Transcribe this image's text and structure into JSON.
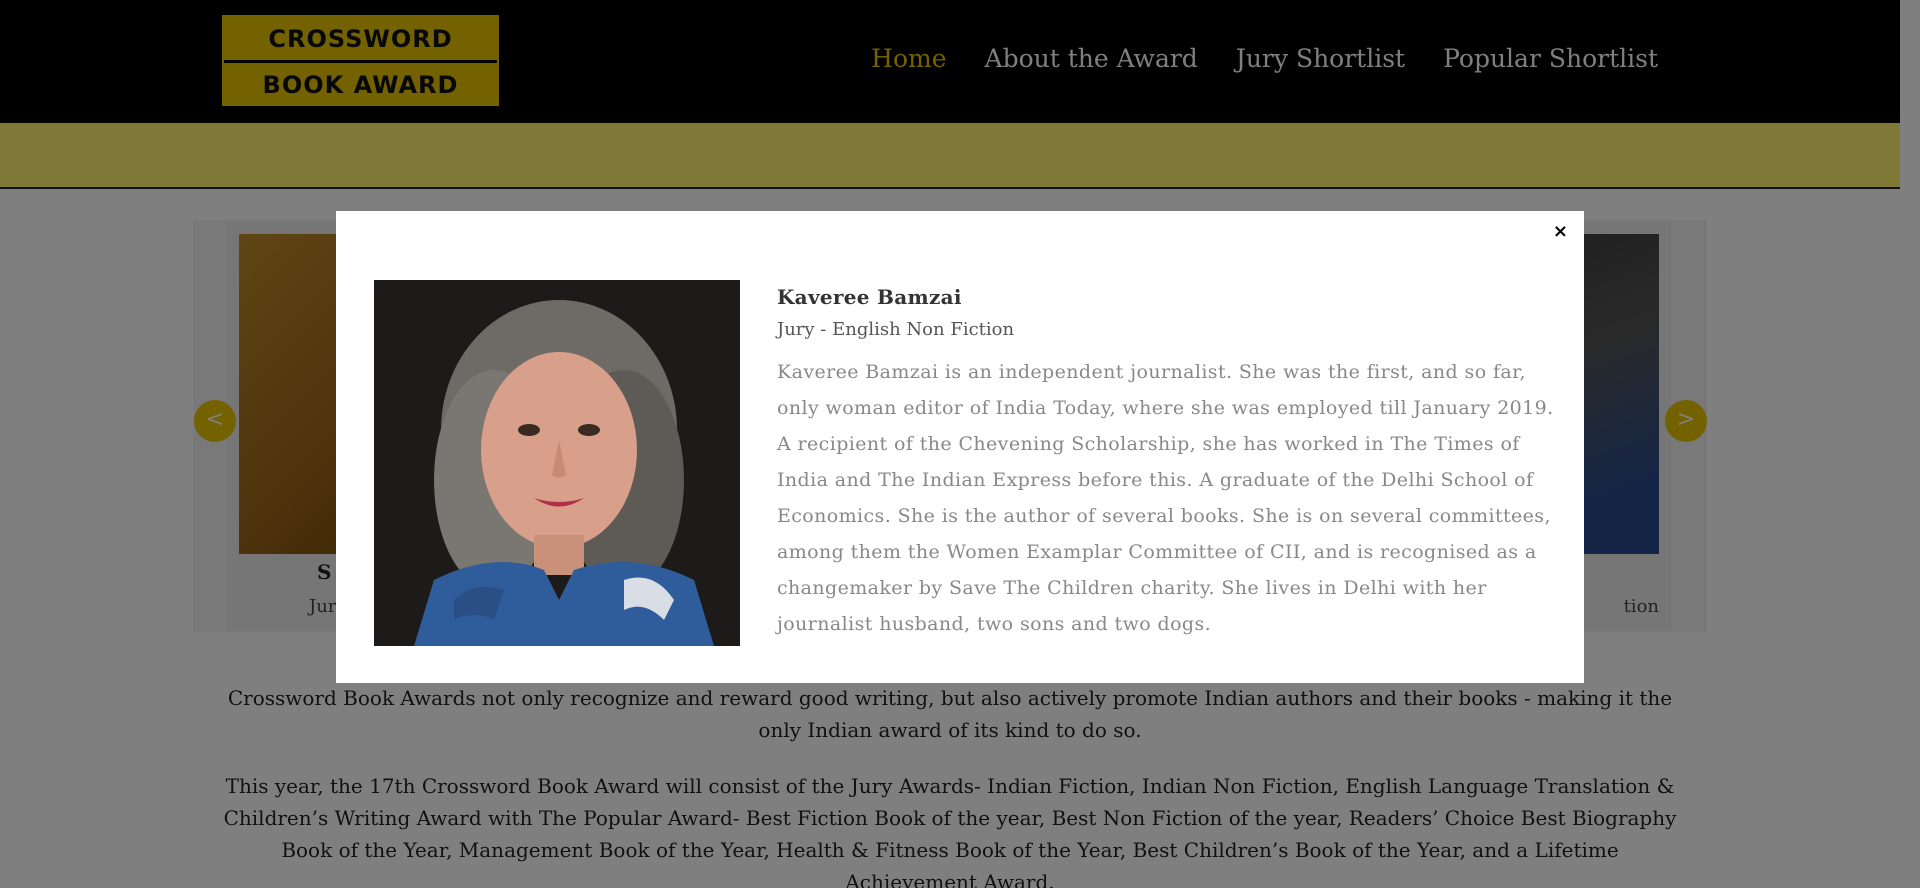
{
  "header": {
    "logo_line1": "CROSSWORD",
    "logo_line2": "BOOK AWARD",
    "nav": [
      {
        "label": "Home",
        "active": true
      },
      {
        "label": "About the Award",
        "active": false
      },
      {
        "label": "Jury Shortlist",
        "active": false
      },
      {
        "label": "Popular Shortlist",
        "active": false
      }
    ]
  },
  "carousel": {
    "left_card": {
      "name": "S",
      "sub": "Jur"
    },
    "right_card": {
      "sub": "tion"
    },
    "prev_label": "<",
    "next_label": ">"
  },
  "intro": {
    "p1": "Crossword Book Awards not only recognize and reward good writing, but also actively promote Indian authors and their books - making it the only Indian award of its kind to do so.",
    "p2": "This year, the 17th Crossword Book Award will consist of the Jury Awards- Indian Fiction, Indian Non Fiction, English Language Translation & Children’s Writing Award with The Popular Award- Best Fiction Book of the year, Best Non Fiction of the year, Readers’ Choice Best Biography Book of the Year, Management Book of the Year, Health & Fitness Book of the Year, Best Children’s Book of the Year, and a Lifetime Achievement Award."
  },
  "modal": {
    "close_label": "×",
    "name": "Kaveree Bamzai",
    "role": "Jury - English Non Fiction",
    "bio": "Kaveree Bamzai is an independent journalist. She was the first, and so far, only woman editor of India Today, where she was employed till January 2019. A recipient of the Chevening Scholarship, she has worked in The Times of India and The Indian Express before this. A graduate of the Delhi School of Economics. She is the author of several books. She is on several committees, among them the Women Examplar Committee of CII, and is recognised as a changemaker by Save The Children charity. She lives in Delhi with her journalist husband, two sons and two dogs."
  },
  "colors": {
    "accent": "#e8c200",
    "header_bg": "#000000",
    "band": "#fff06c"
  }
}
